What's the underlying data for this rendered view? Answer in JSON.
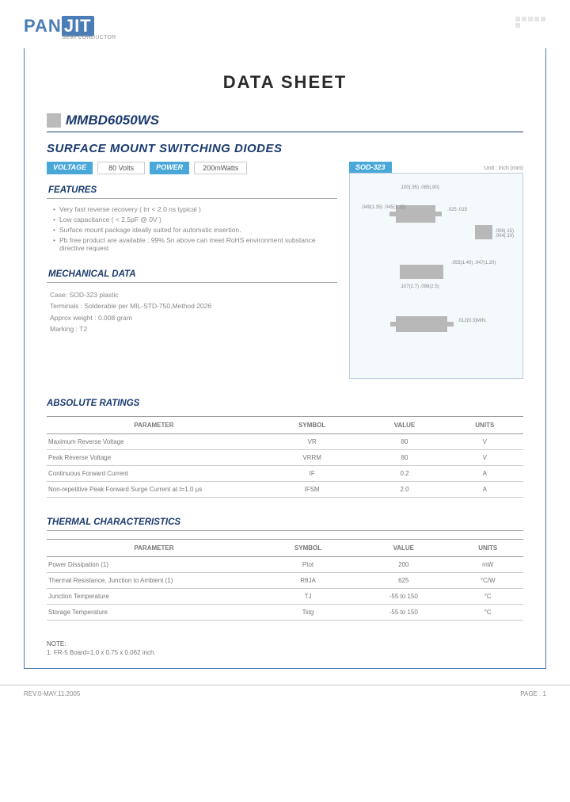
{
  "logo": {
    "left": "PAN",
    "right": "JIT",
    "sub": "SEMI\nCONDUCTOR"
  },
  "title": "DATA SHEET",
  "part_number": "MMBD6050WS",
  "subtitle": "SURFACE MOUNT SWITCHING DIODES",
  "specs": {
    "voltage_label": "VOLTAGE",
    "voltage_value": "80 Volts",
    "power_label": "POWER",
    "power_value": "200mWatts"
  },
  "package": {
    "name": "SOD-323",
    "unit": "Unit : inch (mm)"
  },
  "sections": {
    "features_head": "FEATURES",
    "features": [
      "Very fast reverse recovery ( trr < 2.0 ns typical )",
      "Low capacitance ( < 2.5pF @ 0V )",
      "Surface mount package ideally suited for automatic insertion.",
      "Pb free product are available : 99% Sn above can meet RoHS environment substance directive request"
    ],
    "mech_head": "MECHANICAL DATA",
    "mech": {
      "case": "Case: SOD-323  plastic",
      "terminals": "Terminals : Solderable per MIL-STD-750,Method 2026",
      "weight": "Approx weight : 0.008 gram",
      "marking": "Marking : T2"
    },
    "abs_head": "ABSOLUTE RATINGS",
    "thermal_head": "THERMAL CHARACTERISTICS"
  },
  "pkg_dims": {
    "d1": ".100(.95)\n.085(.90)",
    "d2": ".049(1.35)\n.045(1.15)",
    "d3": ".025\n.015",
    "d4": ".055(1.40)\n.047(1.20)",
    "d5": ".107(2.7)\n.098(2.5)",
    "d6": ".012(0.3)MIN.",
    "d7": ".006(.15)\n.004(.10)"
  },
  "table_headers": {
    "param": "PARAMETER",
    "symbol": "SYMBOL",
    "value": "VALUE",
    "units": "UNITS"
  },
  "abs_ratings": [
    {
      "param": "Maximum Reverse Voltage",
      "symbol": "VR",
      "value": "80",
      "units": "V"
    },
    {
      "param": "Peak Reverse Voltage",
      "symbol": "VRRM",
      "value": "80",
      "units": "V"
    },
    {
      "param": "Continuous Forward Current",
      "symbol": "IF",
      "value": "0.2",
      "units": "A"
    },
    {
      "param": "Non-repetitive Peak Forward Surge Current at t=1.0 μs",
      "symbol": "IFSM",
      "value": "2.0",
      "units": "A"
    }
  ],
  "thermal": [
    {
      "param": "Power Dissipation (1)",
      "symbol": "Ptot",
      "value": "200",
      "units": "mW"
    },
    {
      "param": "Thermal Resistance, Junction to Ambient (1)",
      "symbol": "RθJA",
      "value": "625",
      "units": "°C/W"
    },
    {
      "param": "Junction Temperature",
      "symbol": "TJ",
      "value": "-55 to 150",
      "units": "°C"
    },
    {
      "param": "Storage Temperature",
      "symbol": "Tstg",
      "value": "-55 to 150",
      "units": "°C"
    }
  ],
  "note": {
    "title": "NOTE:",
    "text": "1. FR-5 Board=1.0 x 0.75 x 0.062 inch."
  },
  "footer": {
    "rev": "REV.0-MAY.11.2005",
    "page": "PAGE .  1"
  }
}
